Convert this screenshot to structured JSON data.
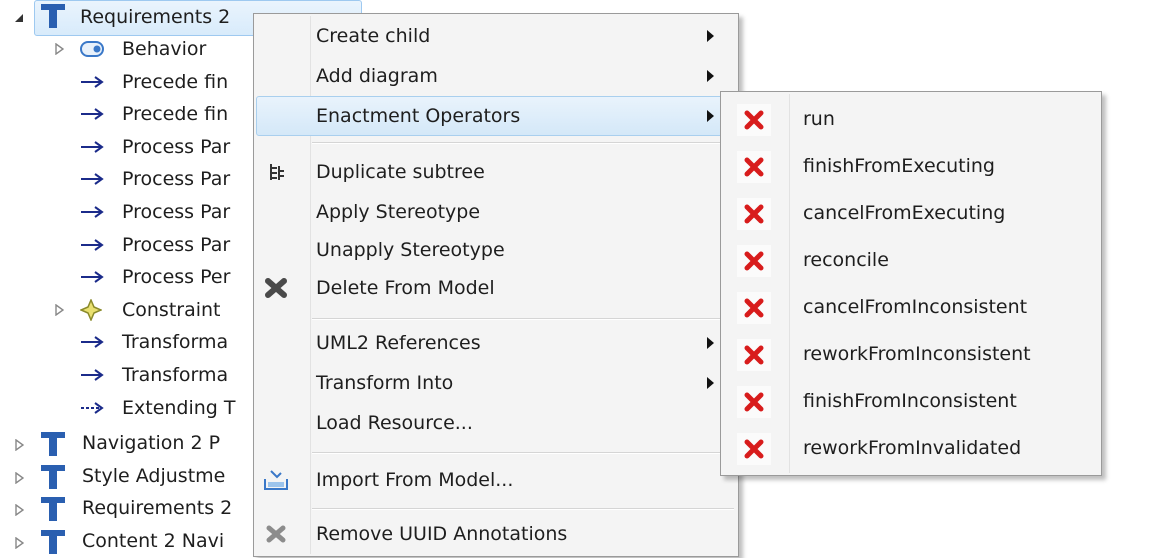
{
  "tree": {
    "root": {
      "label": "Requirements 2"
    },
    "rows": [
      {
        "label": "Behavior",
        "icon": "behavior-icon",
        "expandable": true
      },
      {
        "label": "Precede fin",
        "icon": "arrow-right-icon"
      },
      {
        "label": "Precede fin",
        "icon": "arrow-right-icon"
      },
      {
        "label": "Process Par",
        "icon": "arrow-right-icon"
      },
      {
        "label": "Process Par",
        "icon": "arrow-right-icon"
      },
      {
        "label": "Process Par",
        "icon": "arrow-right-icon"
      },
      {
        "label": "Process Par",
        "icon": "arrow-right-icon"
      },
      {
        "label": "Process Per",
        "icon": "arrow-right-icon"
      },
      {
        "label": "Constraint",
        "icon": "constraint-icon",
        "expandable": true
      },
      {
        "label": "Transforma",
        "icon": "arrow-right-icon"
      },
      {
        "label": "Transforma",
        "icon": "arrow-right-icon"
      },
      {
        "label": "Extending T",
        "icon": "dashed-arrow-icon"
      }
    ],
    "siblings": [
      {
        "label": "Navigation 2 P"
      },
      {
        "label": "Style Adjustme"
      },
      {
        "label": "Requirements 2"
      },
      {
        "label": "Content 2 Navi"
      }
    ]
  },
  "context_menu": {
    "items": [
      {
        "label": "Create child",
        "submenu": true
      },
      {
        "label": "Add diagram",
        "submenu": true
      },
      {
        "label": "Enactment Operators",
        "submenu": true,
        "highlighted": true
      },
      {
        "label": "Duplicate subtree",
        "icon": "duplicate-tree-icon"
      },
      {
        "label": "Apply Stereotype"
      },
      {
        "label": "Unapply Stereotype"
      },
      {
        "label": "Delete From Model",
        "icon": "delete-icon"
      },
      {
        "label": "UML2 References",
        "submenu": true
      },
      {
        "label": "Transform Into",
        "submenu": true
      },
      {
        "label": "Load Resource..."
      },
      {
        "label": "Import From Model...",
        "icon": "import-icon"
      },
      {
        "label": "Remove UUID Annotations",
        "icon": "remove-icon"
      }
    ]
  },
  "submenu": {
    "title": "Enactment Operators",
    "items": [
      {
        "label": "run"
      },
      {
        "label": "finishFromExecuting"
      },
      {
        "label": "cancelFromExecuting"
      },
      {
        "label": "reconcile"
      },
      {
        "label": "cancelFromInconsistent"
      },
      {
        "label": "reworkFromInconsistent"
      },
      {
        "label": "finishFromInconsistent"
      },
      {
        "label": "reworkFromInvalidated"
      }
    ]
  },
  "colors": {
    "tree_type_icon": "#2a5fb0",
    "arrow": "#1b2b8a",
    "red_x": "#d81c1c",
    "highlight": "#d4e8f8"
  }
}
